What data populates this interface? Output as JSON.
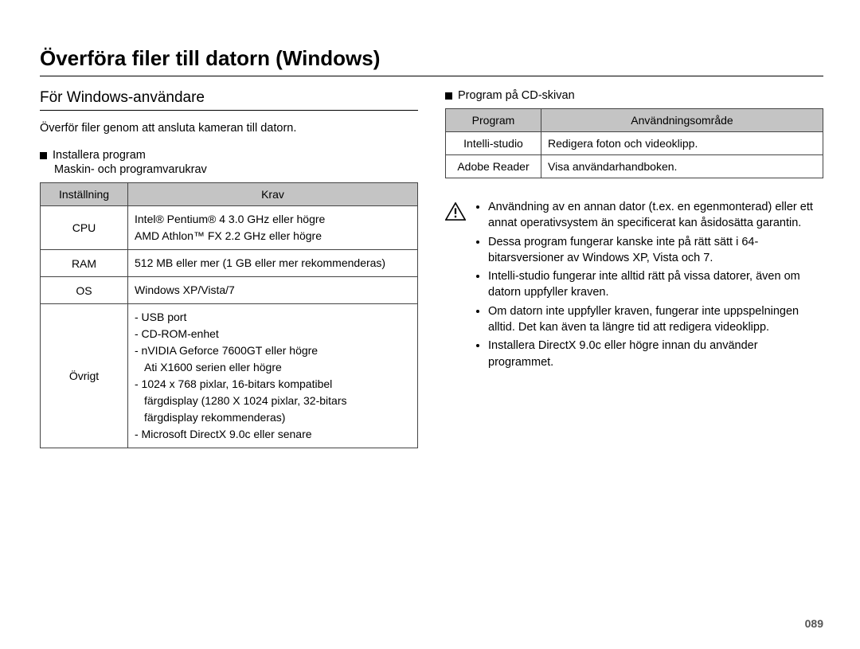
{
  "title": "Överföra filer till datorn (Windows)",
  "page_number": "089",
  "left": {
    "subheading": "För Windows-användare",
    "intro": "Överför filer genom att ansluta kameran till datorn.",
    "install_heading": "Installera program",
    "install_sub": "Maskin- och programvarukrav",
    "table": {
      "headers": [
        "Inställning",
        "Krav"
      ],
      "rows": [
        {
          "label": "CPU",
          "lines": [
            "Intel® Pentium® 4 3.0 GHz eller högre",
            "AMD Athlon™ FX 2.2 GHz eller högre"
          ]
        },
        {
          "label": "RAM",
          "lines": [
            "512 MB eller mer (1 GB eller mer rekommenderas)"
          ]
        },
        {
          "label": "OS",
          "lines": [
            "Windows XP/Vista/7"
          ]
        },
        {
          "label": "Övrigt",
          "lines": [
            "- USB port",
            "- CD-ROM-enhet",
            "- nVIDIA Geforce 7600GT eller högre",
            "  Ati X1600 serien eller högre",
            "- 1024 x 768 pixlar, 16-bitars kompatibel",
            "  färgdisplay (1280 X 1024 pixlar, 32-bitars",
            "  färgdisplay rekommenderas)",
            "- Microsoft DirectX 9.0c eller senare"
          ]
        }
      ]
    }
  },
  "right": {
    "cd_heading": "Program på CD-skivan",
    "prog_table": {
      "headers": [
        "Program",
        "Användningsområde"
      ],
      "rows": [
        {
          "name": "Intelli-studio",
          "use": "Redigera foton och videoklipp."
        },
        {
          "name": "Adobe Reader",
          "use": "Visa användarhandboken."
        }
      ]
    },
    "warnings": [
      "Användning av en annan dator (t.ex. en egenmonterad) eller ett annat operativsystem än specificerat kan åsidosätta garantin.",
      "Dessa program fungerar kanske inte på rätt sätt i 64-bitarsversioner av Windows XP, Vista och 7.",
      "Intelli-studio fungerar inte alltid rätt på vissa datorer, även om datorn uppfyller kraven.",
      "Om datorn inte uppfyller kraven, fungerar inte uppspelningen alltid. Det kan även ta längre tid att redigera videoklipp.",
      "Installera DirectX 9.0c eller högre innan du använder programmet."
    ]
  }
}
